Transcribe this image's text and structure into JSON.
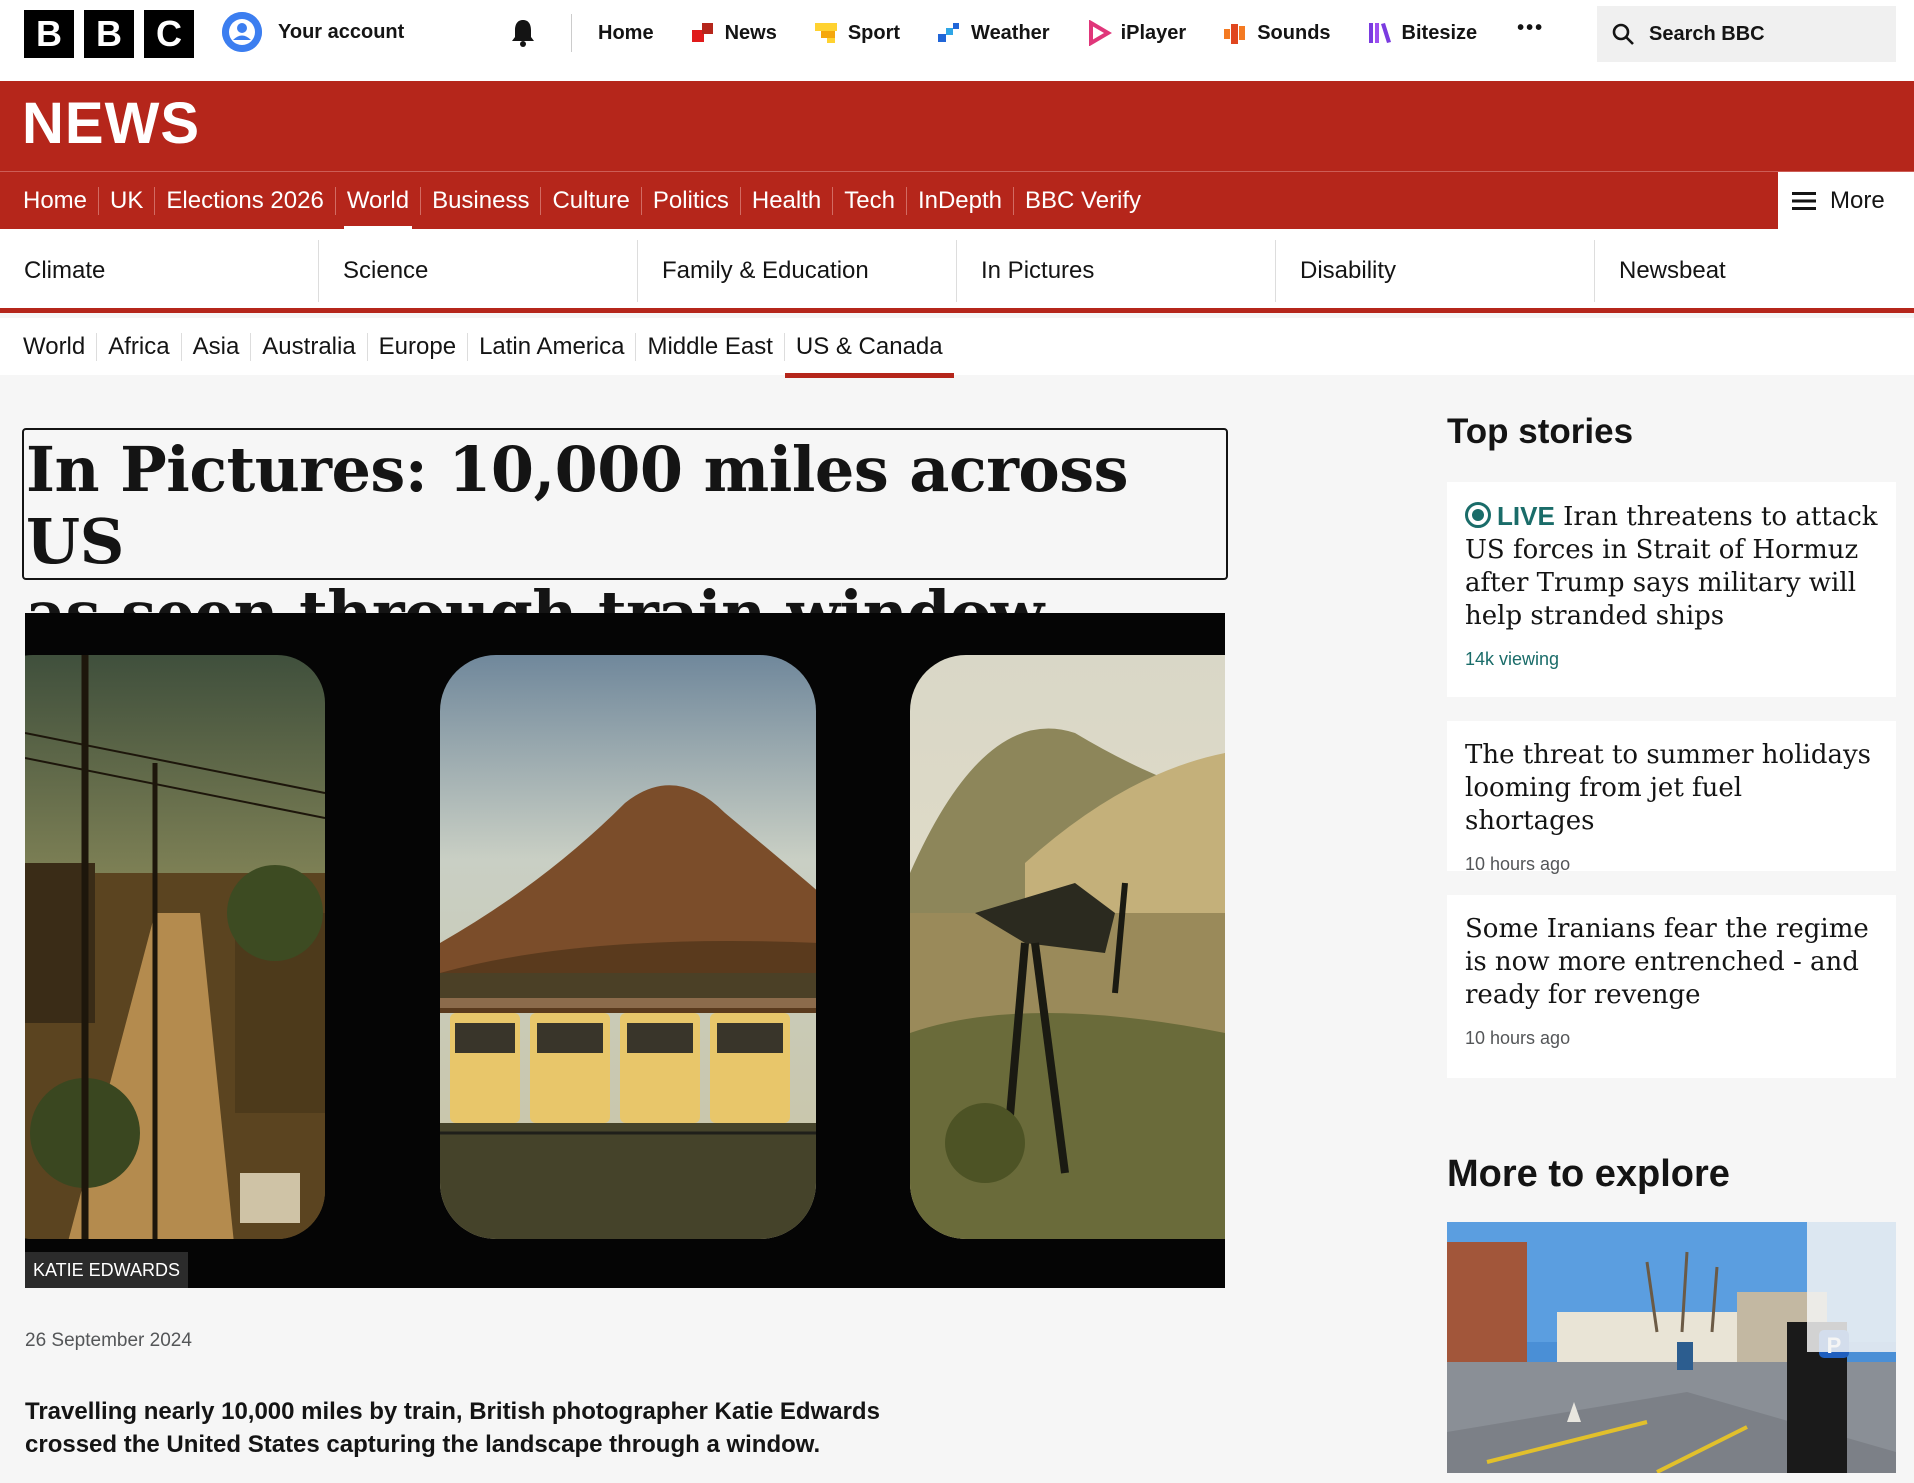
{
  "brand": {
    "letters": [
      "B",
      "B",
      "C"
    ]
  },
  "account": {
    "label": "Your account"
  },
  "top_nav": [
    {
      "label": "Home",
      "icon": "none"
    },
    {
      "label": "News",
      "icon": "news-icon"
    },
    {
      "label": "Sport",
      "icon": "sport-icon"
    },
    {
      "label": "Weather",
      "icon": "weather-icon"
    },
    {
      "label": "iPlayer",
      "icon": "iplayer-icon"
    },
    {
      "label": "Sounds",
      "icon": "sounds-icon"
    },
    {
      "label": "Bitesize",
      "icon": "bitesize-icon"
    }
  ],
  "more_dots": "•••",
  "search": {
    "label": "Search BBC"
  },
  "news_band": {
    "title": "NEWS",
    "more_label": "More"
  },
  "section_nav": [
    "Home",
    "UK",
    "Elections 2026",
    "World",
    "Business",
    "Culture",
    "Politics",
    "Health",
    "Tech",
    "InDepth",
    "BBC Verify"
  ],
  "section_active": "World",
  "sub_nav": [
    "Climate",
    "Science",
    "Family & Education",
    "In Pictures",
    "Disability",
    "Newsbeat"
  ],
  "region_nav": [
    "World",
    "Africa",
    "Asia",
    "Australia",
    "Europe",
    "Latin America",
    "Middle East",
    "US & Canada"
  ],
  "region_active": "US & Canada",
  "article": {
    "headline_line1": "In Pictures: 10,000 miles across US",
    "headline_line2": "as seen through train window",
    "image_credit": "KATIE EDWARDS",
    "date": "26 September 2024",
    "summary": "Travelling nearly 10,000 miles by train, British photographer Katie Edwards crossed the United States capturing the landscape through a window."
  },
  "top_stories": {
    "title": "Top stories",
    "items": [
      {
        "live": "LIVE",
        "title": "Iran threatens to attack US forces in Strait of Hormuz after Trump says military will help stranded ships",
        "meta": "14k viewing"
      },
      {
        "live": "",
        "title": "The threat to summer holidays looming from jet fuel shortages",
        "meta": "10 hours ago"
      },
      {
        "live": "",
        "title": "Some Iranians fear the regime is now more entrenched - and ready for revenge",
        "meta": "10 hours ago"
      }
    ]
  },
  "more_to_explore": {
    "title": "More to explore"
  },
  "colors": {
    "news_red": "#b5261b",
    "live_teal": "#1a6c69",
    "page_bg": "#f6f6f6"
  }
}
